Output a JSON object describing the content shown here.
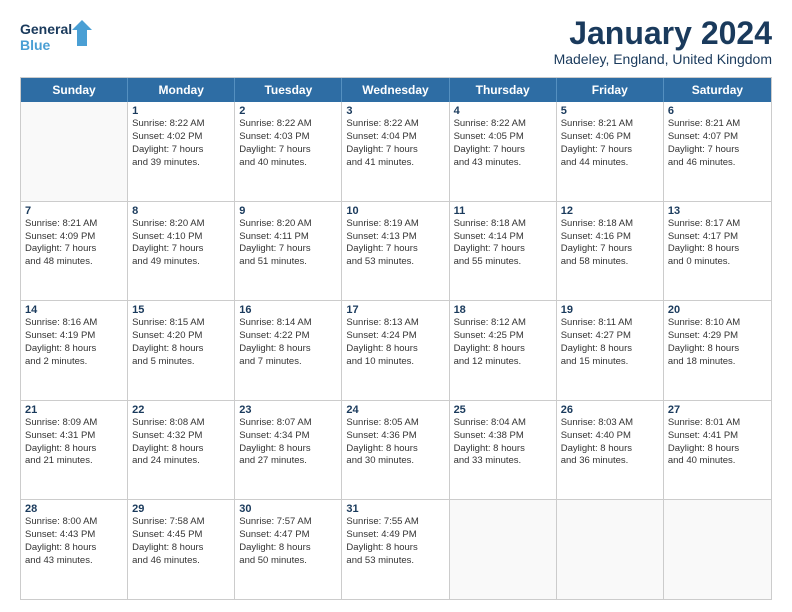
{
  "logo": {
    "line1": "General",
    "line2": "Blue"
  },
  "title": "January 2024",
  "location": "Madeley, England, United Kingdom",
  "header_days": [
    "Sunday",
    "Monday",
    "Tuesday",
    "Wednesday",
    "Thursday",
    "Friday",
    "Saturday"
  ],
  "weeks": [
    [
      {
        "day": "",
        "sunrise": "",
        "sunset": "",
        "daylight": ""
      },
      {
        "day": "1",
        "sunrise": "Sunrise: 8:22 AM",
        "sunset": "Sunset: 4:02 PM",
        "daylight": "Daylight: 7 hours",
        "daylight2": "and 39 minutes."
      },
      {
        "day": "2",
        "sunrise": "Sunrise: 8:22 AM",
        "sunset": "Sunset: 4:03 PM",
        "daylight": "Daylight: 7 hours",
        "daylight2": "and 40 minutes."
      },
      {
        "day": "3",
        "sunrise": "Sunrise: 8:22 AM",
        "sunset": "Sunset: 4:04 PM",
        "daylight": "Daylight: 7 hours",
        "daylight2": "and 41 minutes."
      },
      {
        "day": "4",
        "sunrise": "Sunrise: 8:22 AM",
        "sunset": "Sunset: 4:05 PM",
        "daylight": "Daylight: 7 hours",
        "daylight2": "and 43 minutes."
      },
      {
        "day": "5",
        "sunrise": "Sunrise: 8:21 AM",
        "sunset": "Sunset: 4:06 PM",
        "daylight": "Daylight: 7 hours",
        "daylight2": "and 44 minutes."
      },
      {
        "day": "6",
        "sunrise": "Sunrise: 8:21 AM",
        "sunset": "Sunset: 4:07 PM",
        "daylight": "Daylight: 7 hours",
        "daylight2": "and 46 minutes."
      }
    ],
    [
      {
        "day": "7",
        "sunrise": "Sunrise: 8:21 AM",
        "sunset": "Sunset: 4:09 PM",
        "daylight": "Daylight: 7 hours",
        "daylight2": "and 48 minutes."
      },
      {
        "day": "8",
        "sunrise": "Sunrise: 8:20 AM",
        "sunset": "Sunset: 4:10 PM",
        "daylight": "Daylight: 7 hours",
        "daylight2": "and 49 minutes."
      },
      {
        "day": "9",
        "sunrise": "Sunrise: 8:20 AM",
        "sunset": "Sunset: 4:11 PM",
        "daylight": "Daylight: 7 hours",
        "daylight2": "and 51 minutes."
      },
      {
        "day": "10",
        "sunrise": "Sunrise: 8:19 AM",
        "sunset": "Sunset: 4:13 PM",
        "daylight": "Daylight: 7 hours",
        "daylight2": "and 53 minutes."
      },
      {
        "day": "11",
        "sunrise": "Sunrise: 8:18 AM",
        "sunset": "Sunset: 4:14 PM",
        "daylight": "Daylight: 7 hours",
        "daylight2": "and 55 minutes."
      },
      {
        "day": "12",
        "sunrise": "Sunrise: 8:18 AM",
        "sunset": "Sunset: 4:16 PM",
        "daylight": "Daylight: 7 hours",
        "daylight2": "and 58 minutes."
      },
      {
        "day": "13",
        "sunrise": "Sunrise: 8:17 AM",
        "sunset": "Sunset: 4:17 PM",
        "daylight": "Daylight: 8 hours",
        "daylight2": "and 0 minutes."
      }
    ],
    [
      {
        "day": "14",
        "sunrise": "Sunrise: 8:16 AM",
        "sunset": "Sunset: 4:19 PM",
        "daylight": "Daylight: 8 hours",
        "daylight2": "and 2 minutes."
      },
      {
        "day": "15",
        "sunrise": "Sunrise: 8:15 AM",
        "sunset": "Sunset: 4:20 PM",
        "daylight": "Daylight: 8 hours",
        "daylight2": "and 5 minutes."
      },
      {
        "day": "16",
        "sunrise": "Sunrise: 8:14 AM",
        "sunset": "Sunset: 4:22 PM",
        "daylight": "Daylight: 8 hours",
        "daylight2": "and 7 minutes."
      },
      {
        "day": "17",
        "sunrise": "Sunrise: 8:13 AM",
        "sunset": "Sunset: 4:24 PM",
        "daylight": "Daylight: 8 hours",
        "daylight2": "and 10 minutes."
      },
      {
        "day": "18",
        "sunrise": "Sunrise: 8:12 AM",
        "sunset": "Sunset: 4:25 PM",
        "daylight": "Daylight: 8 hours",
        "daylight2": "and 12 minutes."
      },
      {
        "day": "19",
        "sunrise": "Sunrise: 8:11 AM",
        "sunset": "Sunset: 4:27 PM",
        "daylight": "Daylight: 8 hours",
        "daylight2": "and 15 minutes."
      },
      {
        "day": "20",
        "sunrise": "Sunrise: 8:10 AM",
        "sunset": "Sunset: 4:29 PM",
        "daylight": "Daylight: 8 hours",
        "daylight2": "and 18 minutes."
      }
    ],
    [
      {
        "day": "21",
        "sunrise": "Sunrise: 8:09 AM",
        "sunset": "Sunset: 4:31 PM",
        "daylight": "Daylight: 8 hours",
        "daylight2": "and 21 minutes."
      },
      {
        "day": "22",
        "sunrise": "Sunrise: 8:08 AM",
        "sunset": "Sunset: 4:32 PM",
        "daylight": "Daylight: 8 hours",
        "daylight2": "and 24 minutes."
      },
      {
        "day": "23",
        "sunrise": "Sunrise: 8:07 AM",
        "sunset": "Sunset: 4:34 PM",
        "daylight": "Daylight: 8 hours",
        "daylight2": "and 27 minutes."
      },
      {
        "day": "24",
        "sunrise": "Sunrise: 8:05 AM",
        "sunset": "Sunset: 4:36 PM",
        "daylight": "Daylight: 8 hours",
        "daylight2": "and 30 minutes."
      },
      {
        "day": "25",
        "sunrise": "Sunrise: 8:04 AM",
        "sunset": "Sunset: 4:38 PM",
        "daylight": "Daylight: 8 hours",
        "daylight2": "and 33 minutes."
      },
      {
        "day": "26",
        "sunrise": "Sunrise: 8:03 AM",
        "sunset": "Sunset: 4:40 PM",
        "daylight": "Daylight: 8 hours",
        "daylight2": "and 36 minutes."
      },
      {
        "day": "27",
        "sunrise": "Sunrise: 8:01 AM",
        "sunset": "Sunset: 4:41 PM",
        "daylight": "Daylight: 8 hours",
        "daylight2": "and 40 minutes."
      }
    ],
    [
      {
        "day": "28",
        "sunrise": "Sunrise: 8:00 AM",
        "sunset": "Sunset: 4:43 PM",
        "daylight": "Daylight: 8 hours",
        "daylight2": "and 43 minutes."
      },
      {
        "day": "29",
        "sunrise": "Sunrise: 7:58 AM",
        "sunset": "Sunset: 4:45 PM",
        "daylight": "Daylight: 8 hours",
        "daylight2": "and 46 minutes."
      },
      {
        "day": "30",
        "sunrise": "Sunrise: 7:57 AM",
        "sunset": "Sunset: 4:47 PM",
        "daylight": "Daylight: 8 hours",
        "daylight2": "and 50 minutes."
      },
      {
        "day": "31",
        "sunrise": "Sunrise: 7:55 AM",
        "sunset": "Sunset: 4:49 PM",
        "daylight": "Daylight: 8 hours",
        "daylight2": "and 53 minutes."
      },
      {
        "day": "",
        "sunrise": "",
        "sunset": "",
        "daylight": "",
        "daylight2": ""
      },
      {
        "day": "",
        "sunrise": "",
        "sunset": "",
        "daylight": "",
        "daylight2": ""
      },
      {
        "day": "",
        "sunrise": "",
        "sunset": "",
        "daylight": "",
        "daylight2": ""
      }
    ]
  ]
}
